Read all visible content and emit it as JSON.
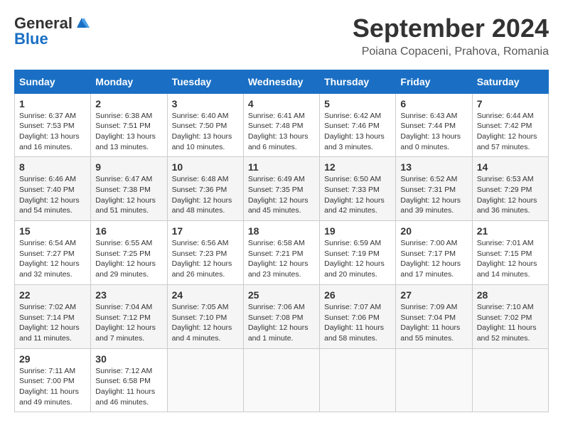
{
  "logo": {
    "general": "General",
    "blue": "Blue"
  },
  "title": "September 2024",
  "location": "Poiana Copaceni, Prahova, Romania",
  "days_of_week": [
    "Sunday",
    "Monday",
    "Tuesday",
    "Wednesday",
    "Thursday",
    "Friday",
    "Saturday"
  ],
  "weeks": [
    [
      {
        "day": "1",
        "sunrise": "6:37 AM",
        "sunset": "7:53 PM",
        "daylight": "13 hours and 16 minutes."
      },
      {
        "day": "2",
        "sunrise": "6:38 AM",
        "sunset": "7:51 PM",
        "daylight": "13 hours and 13 minutes."
      },
      {
        "day": "3",
        "sunrise": "6:40 AM",
        "sunset": "7:50 PM",
        "daylight": "13 hours and 10 minutes."
      },
      {
        "day": "4",
        "sunrise": "6:41 AM",
        "sunset": "7:48 PM",
        "daylight": "13 hours and 6 minutes."
      },
      {
        "day": "5",
        "sunrise": "6:42 AM",
        "sunset": "7:46 PM",
        "daylight": "13 hours and 3 minutes."
      },
      {
        "day": "6",
        "sunrise": "6:43 AM",
        "sunset": "7:44 PM",
        "daylight": "13 hours and 0 minutes."
      },
      {
        "day": "7",
        "sunrise": "6:44 AM",
        "sunset": "7:42 PM",
        "daylight": "12 hours and 57 minutes."
      }
    ],
    [
      {
        "day": "8",
        "sunrise": "6:46 AM",
        "sunset": "7:40 PM",
        "daylight": "12 hours and 54 minutes."
      },
      {
        "day": "9",
        "sunrise": "6:47 AM",
        "sunset": "7:38 PM",
        "daylight": "12 hours and 51 minutes."
      },
      {
        "day": "10",
        "sunrise": "6:48 AM",
        "sunset": "7:36 PM",
        "daylight": "12 hours and 48 minutes."
      },
      {
        "day": "11",
        "sunrise": "6:49 AM",
        "sunset": "7:35 PM",
        "daylight": "12 hours and 45 minutes."
      },
      {
        "day": "12",
        "sunrise": "6:50 AM",
        "sunset": "7:33 PM",
        "daylight": "12 hours and 42 minutes."
      },
      {
        "day": "13",
        "sunrise": "6:52 AM",
        "sunset": "7:31 PM",
        "daylight": "12 hours and 39 minutes."
      },
      {
        "day": "14",
        "sunrise": "6:53 AM",
        "sunset": "7:29 PM",
        "daylight": "12 hours and 36 minutes."
      }
    ],
    [
      {
        "day": "15",
        "sunrise": "6:54 AM",
        "sunset": "7:27 PM",
        "daylight": "12 hours and 32 minutes."
      },
      {
        "day": "16",
        "sunrise": "6:55 AM",
        "sunset": "7:25 PM",
        "daylight": "12 hours and 29 minutes."
      },
      {
        "day": "17",
        "sunrise": "6:56 AM",
        "sunset": "7:23 PM",
        "daylight": "12 hours and 26 minutes."
      },
      {
        "day": "18",
        "sunrise": "6:58 AM",
        "sunset": "7:21 PM",
        "daylight": "12 hours and 23 minutes."
      },
      {
        "day": "19",
        "sunrise": "6:59 AM",
        "sunset": "7:19 PM",
        "daylight": "12 hours and 20 minutes."
      },
      {
        "day": "20",
        "sunrise": "7:00 AM",
        "sunset": "7:17 PM",
        "daylight": "12 hours and 17 minutes."
      },
      {
        "day": "21",
        "sunrise": "7:01 AM",
        "sunset": "7:15 PM",
        "daylight": "12 hours and 14 minutes."
      }
    ],
    [
      {
        "day": "22",
        "sunrise": "7:02 AM",
        "sunset": "7:14 PM",
        "daylight": "12 hours and 11 minutes."
      },
      {
        "day": "23",
        "sunrise": "7:04 AM",
        "sunset": "7:12 PM",
        "daylight": "12 hours and 7 minutes."
      },
      {
        "day": "24",
        "sunrise": "7:05 AM",
        "sunset": "7:10 PM",
        "daylight": "12 hours and 4 minutes."
      },
      {
        "day": "25",
        "sunrise": "7:06 AM",
        "sunset": "7:08 PM",
        "daylight": "12 hours and 1 minute."
      },
      {
        "day": "26",
        "sunrise": "7:07 AM",
        "sunset": "7:06 PM",
        "daylight": "11 hours and 58 minutes."
      },
      {
        "day": "27",
        "sunrise": "7:09 AM",
        "sunset": "7:04 PM",
        "daylight": "11 hours and 55 minutes."
      },
      {
        "day": "28",
        "sunrise": "7:10 AM",
        "sunset": "7:02 PM",
        "daylight": "11 hours and 52 minutes."
      }
    ],
    [
      {
        "day": "29",
        "sunrise": "7:11 AM",
        "sunset": "7:00 PM",
        "daylight": "11 hours and 49 minutes."
      },
      {
        "day": "30",
        "sunrise": "7:12 AM",
        "sunset": "6:58 PM",
        "daylight": "11 hours and 46 minutes."
      },
      null,
      null,
      null,
      null,
      null
    ]
  ]
}
